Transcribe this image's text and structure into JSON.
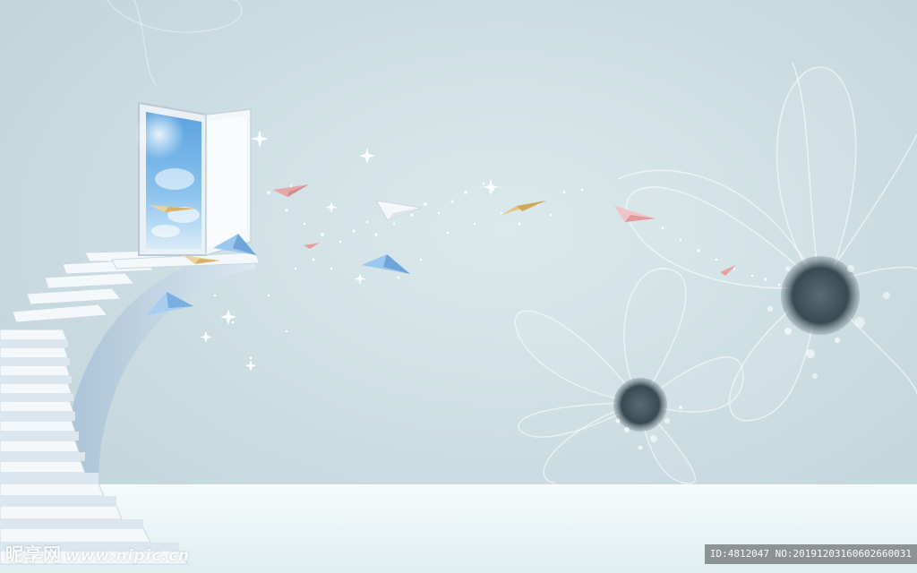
{
  "watermarks": {
    "site_logo_text": "昵享网",
    "site_url": "www.nipic.cn",
    "image_info": "ID:4812047 NO:20191203160602660031"
  },
  "colors": {
    "background": "#c9dbe0",
    "floor": "#eef6f7",
    "stairs": "#f4f8fb",
    "flower_center": "#3a4a52",
    "plane_pink": "#e8a6a6",
    "plane_gold": "#e6c47a",
    "plane_blue": "#7fb3e6",
    "plane_white": "#f5f7fa"
  },
  "scene": {
    "elements": [
      "spiral-staircase",
      "open-door-with-sky",
      "paper-planes",
      "sparkle-trail",
      "line-art-flowers",
      "floor"
    ]
  }
}
